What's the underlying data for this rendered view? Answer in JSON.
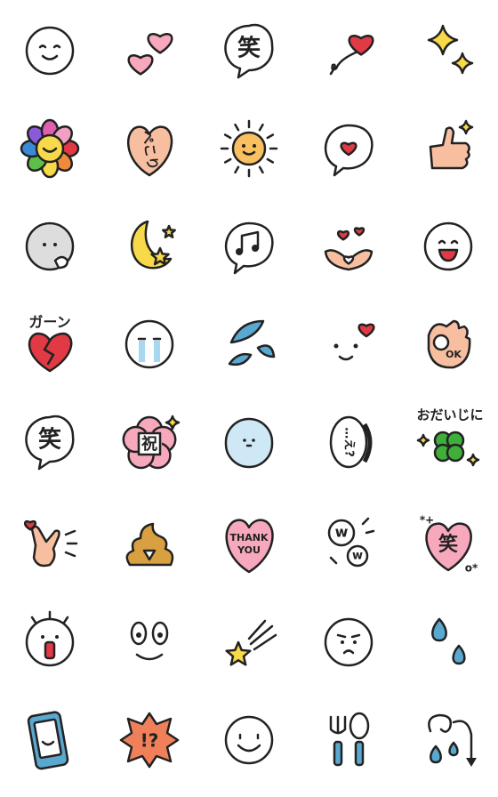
{
  "colors": {
    "outline": "#222222",
    "pink": "#f7a8bd",
    "red": "#e23a44",
    "yellow": "#f8d94a",
    "peach": "#f8bea0",
    "blue": "#5aa8d0",
    "green": "#3fae3a",
    "orange": "#f0805a",
    "brown": "#d8a040"
  },
  "stickers": [
    {
      "kind": "smile-face-icon"
    },
    {
      "kind": "two-hearts-icon"
    },
    {
      "kind": "speech-text-icon",
      "text": "笑"
    },
    {
      "kind": "heart-balloon-icon"
    },
    {
      "kind": "sparkles-icon"
    },
    {
      "kind": "rainbow-flower-icon"
    },
    {
      "kind": "heart-text-icon",
      "text": "ぺこり"
    },
    {
      "kind": "sun-icon"
    },
    {
      "kind": "heart-speech-icon"
    },
    {
      "kind": "thumbs-up-icon"
    },
    {
      "kind": "gray-face-icon"
    },
    {
      "kind": "moon-stars-icon"
    },
    {
      "kind": "music-speech-icon"
    },
    {
      "kind": "heart-hands-icon"
    },
    {
      "kind": "laugh-face-icon"
    },
    {
      "kind": "broken-heart-icon",
      "text": "ガーン"
    },
    {
      "kind": "crying-face-icon"
    },
    {
      "kind": "sweat-drops-icon"
    },
    {
      "kind": "wink-heart-face-icon"
    },
    {
      "kind": "ok-hand-icon",
      "text": "OK"
    },
    {
      "kind": "speech-text-icon",
      "text": "笑"
    },
    {
      "kind": "sakura-text-icon",
      "text": "祝"
    },
    {
      "kind": "blue-face-icon"
    },
    {
      "kind": "ellipsis-speech-icon",
      "text": "…え?"
    },
    {
      "kind": "clover-icon",
      "text": "おだいじに"
    },
    {
      "kind": "peace-hand-icon"
    },
    {
      "kind": "poop-icon"
    },
    {
      "kind": "thank-you-heart-icon",
      "text": "THANK YOU"
    },
    {
      "kind": "w-clouds-icon",
      "text": "w"
    },
    {
      "kind": "pink-heart-text-icon",
      "text": "笑"
    },
    {
      "kind": "shocked-face-icon"
    },
    {
      "kind": "tears-face-icon"
    },
    {
      "kind": "shooting-star-icon"
    },
    {
      "kind": "worried-face-icon"
    },
    {
      "kind": "water-drops-icon"
    },
    {
      "kind": "smartphone-icon"
    },
    {
      "kind": "exclaim-burst-icon",
      "text": "!?"
    },
    {
      "kind": "big-smile-icon"
    },
    {
      "kind": "spoon-fork-icon"
    },
    {
      "kind": "swirl-drops-icon"
    }
  ]
}
